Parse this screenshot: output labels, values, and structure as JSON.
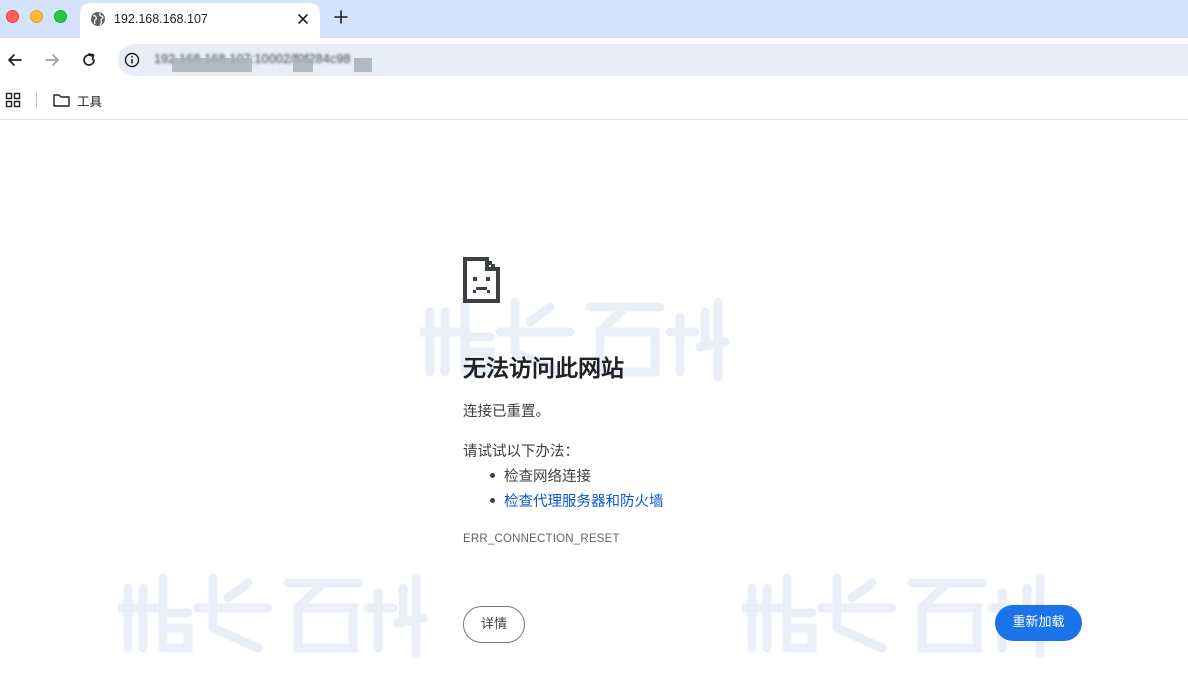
{
  "browser": {
    "tab": {
      "title": "192.168.168.107"
    },
    "address": {
      "url": "192.168.168.107:10002/f0f284c98"
    },
    "bookmarks": [
      {
        "label": "工具"
      }
    ]
  },
  "error_page": {
    "heading": "无法访问此网站",
    "subtitle": "连接已重置。",
    "try_label": "请试试以下办法：",
    "suggestions": [
      {
        "text": "检查网络连接",
        "link": false
      },
      {
        "text": "检查代理服务器和防火墙",
        "link": true
      }
    ],
    "error_code": "ERR_CONNECTION_RESET",
    "details_button": "详情",
    "reload_button": "重新加载"
  },
  "colors": {
    "accent": "#1a73e8",
    "link": "#0b57d0",
    "tabstrip": "#d3e3fd"
  },
  "icons": [
    "globe-icon",
    "close-icon",
    "plus-icon",
    "back-icon",
    "forward-icon",
    "reload-icon",
    "info-icon",
    "apps-icon",
    "folder-icon",
    "sad-document-icon"
  ]
}
